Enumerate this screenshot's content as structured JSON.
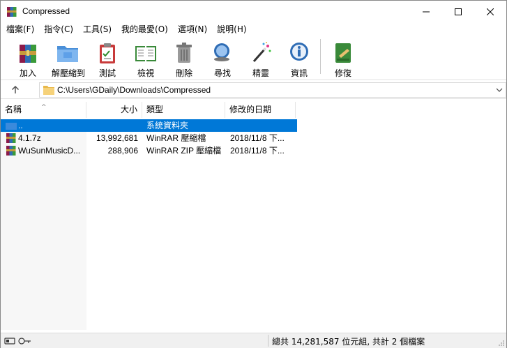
{
  "window": {
    "title": "Compressed"
  },
  "menu": [
    "檔案(F)",
    "指令(C)",
    "工具(S)",
    "我的最愛(O)",
    "選項(N)",
    "說明(H)"
  ],
  "toolbar": {
    "add": "加入",
    "extract": "解壓縮到",
    "test": "測試",
    "view": "檢視",
    "delete": "刪除",
    "find": "尋找",
    "wizard": "精靈",
    "info": "資訊",
    "repair": "修復"
  },
  "address": {
    "path": "C:\\Users\\GDaily\\Downloads\\Compressed"
  },
  "columns": {
    "name": "名稱",
    "size": "大小",
    "type": "類型",
    "date": "修改的日期"
  },
  "files": [
    {
      "name": "..",
      "size": "",
      "type": "系統資料夾",
      "date": "",
      "icon": "parent-folder-icon",
      "selected": true
    },
    {
      "name": "4.1.7z",
      "size": "13,992,681",
      "type": "WinRAR 壓縮檔",
      "date": "2018/11/8 下...",
      "icon": "winrar-archive-icon",
      "selected": false
    },
    {
      "name": "WuSunMusicD...",
      "size": "288,906",
      "type": "WinRAR ZIP 壓縮檔",
      "date": "2018/11/8 下...",
      "icon": "winrar-archive-icon",
      "selected": false
    }
  ],
  "status": {
    "summary": "總共 14,281,587 位元組, 共計 2 個檔案"
  },
  "colors": {
    "selection": "#0078d7",
    "statusbar": "#f0f0f0"
  }
}
